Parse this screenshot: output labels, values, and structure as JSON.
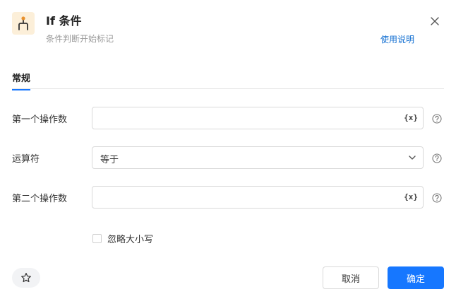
{
  "header": {
    "title": "If 条件",
    "subtitle": "条件判断开始标记",
    "help_link": "使用说明",
    "app_icon": "branch-icon",
    "close_icon": "close-icon"
  },
  "tabs": [
    {
      "label": "常规",
      "active": true
    }
  ],
  "form": {
    "operand1": {
      "label": "第一个操作数",
      "value": "",
      "var_button": "{x}"
    },
    "operator": {
      "label": "运算符",
      "value": "等于"
    },
    "operand2": {
      "label": "第二个操作数",
      "value": "",
      "var_button": "{x}"
    },
    "ignore_case": {
      "label": "忽略大小写",
      "checked": false
    }
  },
  "footer": {
    "cancel_label": "取消",
    "ok_label": "确定",
    "favorite_icon": "star-icon"
  },
  "colors": {
    "accent": "#1677ff",
    "link": "#1470d2",
    "icon_bg": "#fcefd9",
    "icon_orange": "#e8912d"
  }
}
